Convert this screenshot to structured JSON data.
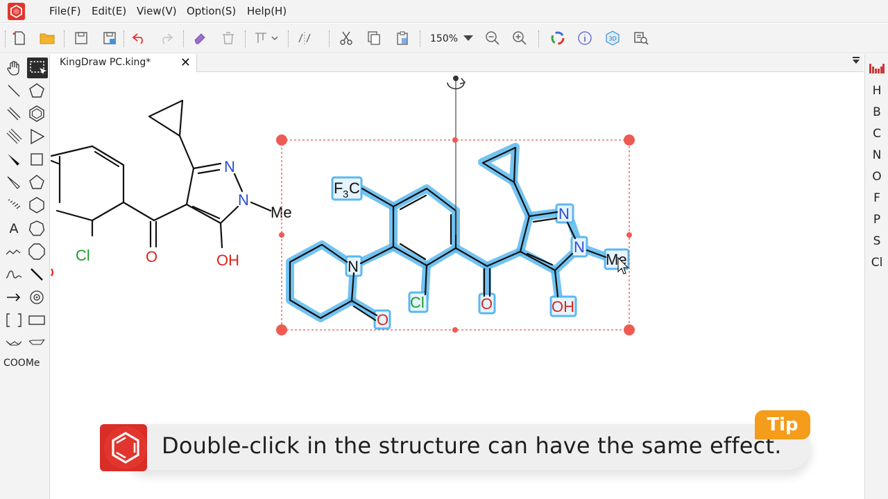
{
  "menu": {
    "items": [
      "File(F)",
      "Edit(E)",
      "View(V)",
      "Option(S)",
      "Help(H)"
    ]
  },
  "toolbar": {
    "zoom": "150%"
  },
  "left_tools": {
    "template_label": "COOMe",
    "text_tool": "A"
  },
  "tab": {
    "title": "KingDraw PC.king*",
    "close": "✕"
  },
  "elements": [
    "H",
    "B",
    "C",
    "N",
    "O",
    "F",
    "P",
    "S",
    "Cl"
  ],
  "molecule_left": {
    "n1": "N",
    "n2": "N",
    "me": "Me",
    "cl": "Cl",
    "o": "O",
    "oh": "OH"
  },
  "molecule_selected": {
    "cf3_f": "F",
    "cf3_sub": "3",
    "cf3_c": "C",
    "n_ring": "N",
    "o_lactam": "O",
    "cl": "Cl",
    "o": "O",
    "n1": "N",
    "n2": "N",
    "me": "Me",
    "oh": "OH"
  },
  "tip": {
    "badge": "Tip",
    "text": "Double-click in the structure can have the same effect."
  },
  "colors": {
    "accent_red": "#e2352d",
    "nitrogen": "#2a4ad6",
    "oxygen": "#d9261c",
    "chlorine": "#1f9b2a",
    "selection": "#54b6ef",
    "tip_orange": "#f59c1a"
  }
}
